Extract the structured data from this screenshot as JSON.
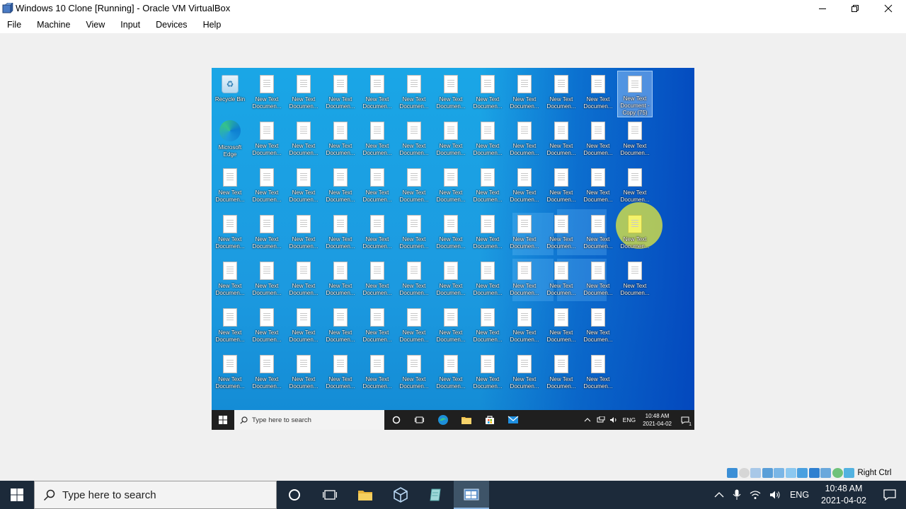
{
  "window": {
    "title": "Windows 10 Clone [Running] - Oracle VM VirtualBox",
    "minimize_icon": "minimize-icon",
    "restore_icon": "restore-icon",
    "close_icon": "close-icon"
  },
  "menu": [
    "File",
    "Machine",
    "View",
    "Input",
    "Devices",
    "Help"
  ],
  "guest": {
    "recycle_bin": "Recycle Bin",
    "edge": "Microsoft Edge",
    "file_label": "New Text Documen...",
    "selected_file_label": "New Text Document - Copy (75)",
    "highlighted_file_label": "New Text Documen...",
    "taskbar": {
      "search_placeholder": "Type here to search",
      "lang": "ENG",
      "time": "10:48 AM",
      "date": "2021-04-02",
      "notification_count": "1"
    }
  },
  "statusbar": {
    "host_key": "Right Ctrl",
    "indicators": [
      "hard-disk-icon",
      "optical-drive-icon",
      "audio-icon",
      "network-icon",
      "usb-icon",
      "shared-folder-icon",
      "display-icon",
      "video-capture-icon",
      "cpu-icon",
      "mouse-integration-icon",
      "keyboard-icon"
    ]
  },
  "host_taskbar": {
    "search_placeholder": "Type here to search",
    "lang": "ENG",
    "time": "10:48 AM",
    "date": "2021-04-02"
  }
}
